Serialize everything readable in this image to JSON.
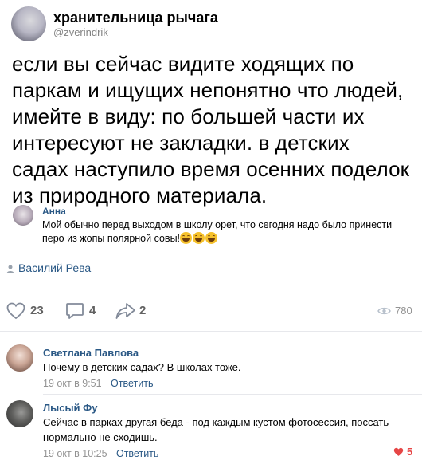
{
  "post": {
    "author": "хранительница рычага",
    "handle": "@zverindrik",
    "text": "если вы сейчас видите ходящих по паркам и ищущих непонятно что людей, имейте в виду: по большей части их интересуют не закладки. в детских садах наступило время осенних поделок из природного материала.",
    "quote": {
      "name": "Анна",
      "text_line1": "Мой обычно перед выходом в школу орет, что сегодня надо было принести",
      "text_line2": "перо из жопы полярной совы!"
    },
    "signer": "Василий Рева",
    "actions": {
      "likes": "23",
      "comments": "4",
      "shares": "2",
      "views": "780"
    }
  },
  "comments": [
    {
      "name": "Светлана Павлова",
      "text": "Почему в детских садах? В школах тоже.",
      "date": "19 окт в 9:51",
      "reply": "Ответить",
      "likes": ""
    },
    {
      "name": "Лысый Фу",
      "text_line1": "Сейчас в парках другая беда - под каждым кустом фотосессия, поссать",
      "text_line2": "нормально не сходишь.",
      "date": "19 окт в 10:25",
      "reply": "Ответить",
      "likes": "5"
    }
  ],
  "colors": {
    "link": "#2a5885",
    "muted": "#939393",
    "like_red": "#e64646"
  }
}
